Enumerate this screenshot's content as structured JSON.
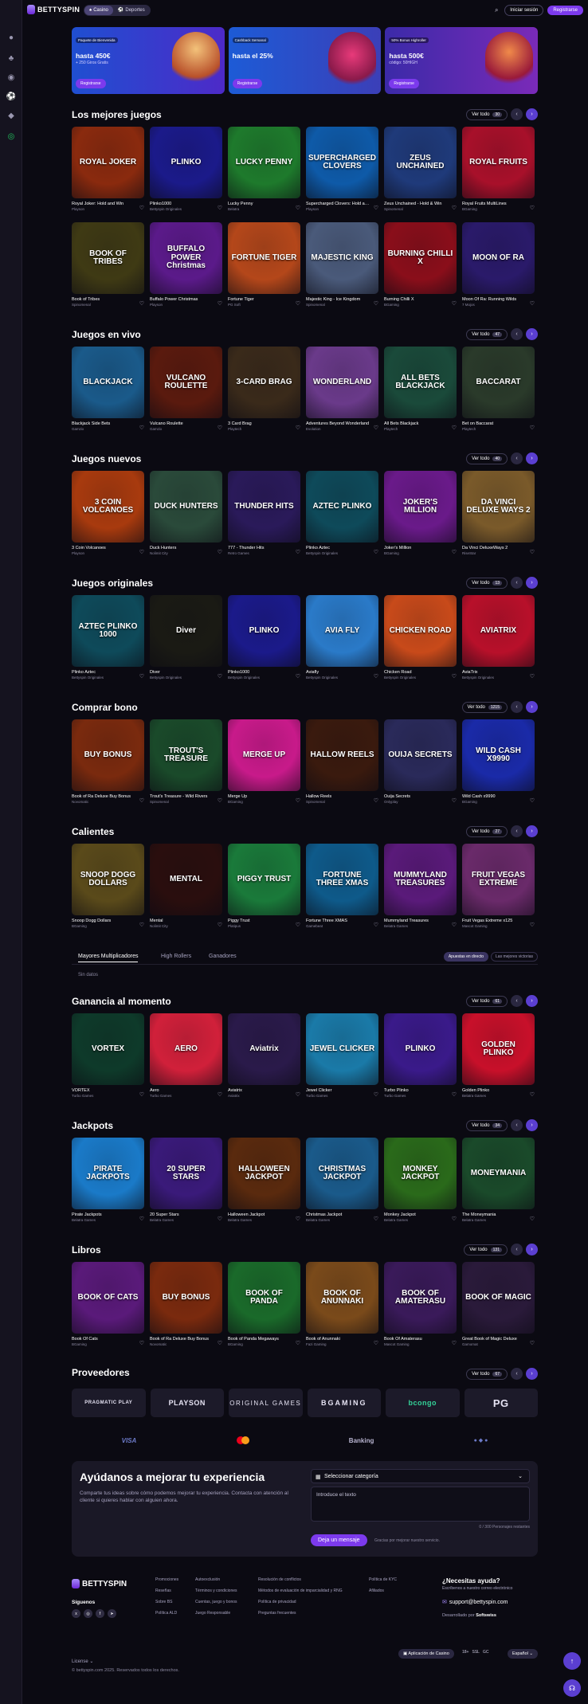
{
  "header": {
    "brand": "BETTYSPIN",
    "tabs": [
      "Casino",
      "Deportes"
    ],
    "login_label": "Iniciar sesión",
    "register_label": "Registrarse"
  },
  "promos": [
    {
      "tag": "Paquete de Bienvenida",
      "amount": "hasta 450€",
      "sub": "+ 250 Giros Gratis",
      "button": "Registrarse",
      "bg": "#1f4fd1"
    },
    {
      "tag": "Cashback Semanal",
      "amount": "hasta el 25%",
      "sub": "",
      "button": "Registrarse",
      "bg": "#1d5bd6"
    },
    {
      "tag": "50% Bonus Highroller",
      "amount": "hasta 500€",
      "sub": "código: 50HIGH",
      "button": "Registrarse",
      "bg": "#3b2aa8"
    }
  ],
  "sections": [
    {
      "title": "Los mejores juegos",
      "vertodo": "Ver todo",
      "count": "30",
      "rows": [
        [
          {
            "name": "Royal Joker: Hold and Win",
            "prov": "Playson",
            "art": "ROYAL JOKER",
            "bg": "#8a2a0e"
          },
          {
            "name": "Plinko1000",
            "prov": "Bettyspin Originales",
            "art": "PLINKO",
            "bg": "#1b1a8a"
          },
          {
            "name": "Lucky Penny",
            "prov": "Belatra",
            "art": "LUCKY PENNY",
            "bg": "#1e7a2c"
          },
          {
            "name": "Supercharged Clovers: Hold and Win",
            "prov": "Playson",
            "art": "SUPERCHARGED CLOVERS",
            "bg": "#0e5aa8"
          },
          {
            "name": "Zeus Unchained - Hold & Win",
            "prov": "Spinomenal",
            "art": "ZEUS UNCHAINED",
            "bg": "#1f3a7a"
          },
          {
            "name": "Royal Fruits MultiLines",
            "prov": "BGaming",
            "art": "ROYAL FRUITS",
            "bg": "#a8102a"
          }
        ],
        [
          {
            "name": "Book of Tribes",
            "prov": "Spinomenal",
            "art": "BOOK OF TRIBES",
            "bg": "#3f3a14"
          },
          {
            "name": "Buffalo Power Christmas",
            "prov": "Playson",
            "art": "BUFFALO POWER Christmas",
            "bg": "#5b1a8a"
          },
          {
            "name": "Fortune Tiger",
            "prov": "PG Soft",
            "art": "FORTUNE TIGER",
            "bg": "#b4471a"
          },
          {
            "name": "Majestic King - Ice Kingdom",
            "prov": "Spinomenal",
            "art": "MAJESTIC KING",
            "bg": "#4a5a7a"
          },
          {
            "name": "Burning Chilli X",
            "prov": "BGaming",
            "art": "BURNING CHILLI X",
            "bg": "#8a0e1a"
          },
          {
            "name": "Moon Of Ra: Running Wilds",
            "prov": "7 Mojos",
            "art": "MOON OF RA",
            "bg": "#2a1a6a"
          }
        ]
      ]
    },
    {
      "title": "Juegos en vivo",
      "vertodo": "Ver todo",
      "count": "47",
      "rows": [
        [
          {
            "name": "Blackjack Side Bets",
            "prov": "Gamzix",
            "art": "BLACKJACK",
            "bg": "#1a5a8a"
          },
          {
            "name": "Vulcano Roulette",
            "prov": "Gamzix",
            "art": "VULCANO ROULETTE",
            "bg": "#5a1a0e"
          },
          {
            "name": "3 Card Brag",
            "prov": "Playtech",
            "art": "3-CARD BRAG",
            "bg": "#3a2a1a"
          },
          {
            "name": "Adventures Beyond Wonderland",
            "prov": "Evolution",
            "art": "WONDERLAND",
            "bg": "#6a3a8a"
          },
          {
            "name": "All Bets Blackjack",
            "prov": "Playtech",
            "art": "ALL BETS BLACKJACK",
            "bg": "#1a4a3a"
          },
          {
            "name": "Bet on Baccarat",
            "prov": "Playtech",
            "art": "BACCARAT",
            "bg": "#2a3a2a"
          }
        ]
      ]
    },
    {
      "title": "Juegos nuevos",
      "vertodo": "Ver todo",
      "count": "40",
      "rows": [
        [
          {
            "name": "3 Coin Volcanoes",
            "prov": "Playson",
            "art": "3 COIN VOLCANOES",
            "bg": "#a83a0e"
          },
          {
            "name": "Duck Hunters",
            "prov": "Nolimit City",
            "art": "DUCK HUNTERS",
            "bg": "#2a4a3a"
          },
          {
            "name": "777 - Thunder Hits",
            "prov": "Retro Games",
            "art": "THUNDER HITS",
            "bg": "#2a1a5a"
          },
          {
            "name": "Plinko Aztec",
            "prov": "Bettyspin Originales",
            "art": "AZTEC PLINKO",
            "bg": "#0e4a5a"
          },
          {
            "name": "Joker's Million",
            "prov": "BGaming",
            "art": "JOKER'S MILLION",
            "bg": "#6a1a8a"
          },
          {
            "name": "Da Vinci DeluxeWays 2",
            "prov": "RiseStar",
            "art": "DA VINCI DELUXE WAYS 2",
            "bg": "#7a5a2a"
          }
        ]
      ]
    },
    {
      "title": "Juegos originales",
      "vertodo": "Ver todo",
      "count": "13",
      "rows": [
        [
          {
            "name": "Plinko Aztec",
            "prov": "Bettyspin Originales",
            "art": "AZTEC PLINKO 1000",
            "bg": "#0e4a5a"
          },
          {
            "name": "Diver",
            "prov": "Bettyspin Originales",
            "art": "Diver",
            "bg": "#1a1a14"
          },
          {
            "name": "Plinko1000",
            "prov": "Bettyspin Originales",
            "art": "PLINKO",
            "bg": "#1b1a8a"
          },
          {
            "name": "Aviafly",
            "prov": "Bettyspin Originales",
            "art": "AVIA FLY",
            "bg": "#2a7ac8"
          },
          {
            "name": "Chicken Road",
            "prov": "Bettyspin Originales",
            "art": "CHICKEN ROAD",
            "bg": "#c84a1a"
          },
          {
            "name": "AviaTrix",
            "prov": "Bettyspin Originales",
            "art": "AVIATRIX",
            "bg": "#b8102a"
          }
        ]
      ]
    },
    {
      "title": "Comprar bono",
      "vertodo": "Ver todo",
      "count": "1215",
      "rows": [
        [
          {
            "name": "Book of Ra Deluxe Buy Bonus",
            "prov": "Novomatic",
            "art": "BUY BONUS",
            "bg": "#7a2a0e"
          },
          {
            "name": "Trout's Treasure - Wild Rivers",
            "prov": "Spinomenal",
            "art": "TROUT'S TREASURE",
            "bg": "#1a4a2a"
          },
          {
            "name": "Merge Up",
            "prov": "BGaming",
            "art": "MERGE UP",
            "bg": "#c81a8a"
          },
          {
            "name": "Hallow Reels",
            "prov": "Spinomenal",
            "art": "HALLOW REELS",
            "bg": "#3a1a0e"
          },
          {
            "name": "Ouija Secrets",
            "prov": "Onlyplay",
            "art": "OUIJA SECRETS",
            "bg": "#2a2a5a"
          },
          {
            "name": "Wild Cash x9990",
            "prov": "BGaming",
            "art": "WILD CASH X9990",
            "bg": "#1a2aa8"
          }
        ]
      ]
    },
    {
      "title": "Calientes",
      "vertodo": "Ver todo",
      "count": "27",
      "rows": [
        [
          {
            "name": "Snoop Dogg Dollars",
            "prov": "BGaming",
            "art": "SNOOP DOGG DOLLARS",
            "bg": "#5a4a1a"
          },
          {
            "name": "Mental",
            "prov": "Nolimit City",
            "art": "MENTAL",
            "bg": "#2a0e0e"
          },
          {
            "name": "Piggy Trust",
            "prov": "Platipus",
            "art": "PIGGY TRUST",
            "bg": "#1a7a3a"
          },
          {
            "name": "Fortune Three XMAS",
            "prov": "Gamebeat",
            "art": "FORTUNE THREE XMAS",
            "bg": "#0e5a8a"
          },
          {
            "name": "Mummyland Treasures",
            "prov": "Belatra Games",
            "art": "MUMMYLAND TREASURES",
            "bg": "#5a1a7a"
          },
          {
            "name": "Fruit Vegas Extreme x125",
            "prov": "Mascot Gaming",
            "art": "FRUIT VEGAS EXTREME",
            "bg": "#6a2a6a"
          }
        ]
      ]
    }
  ],
  "winners": {
    "tabs": [
      "Mayores Multiplicadores",
      "High Rollers",
      "Ganadores"
    ],
    "toggle": [
      "Apuestas en directo",
      "Las mejores victorias"
    ],
    "empty": "Sin datos"
  },
  "sections2": [
    {
      "title": "Ganancia al momento",
      "vertodo": "Ver todo",
      "count": "61",
      "rows": [
        [
          {
            "name": "VORTEX",
            "prov": "Turbo Games",
            "art": "VORTEX",
            "bg": "#0e3a2a"
          },
          {
            "name": "Aero",
            "prov": "Turbo Games",
            "art": "AERO",
            "bg": "#d1203a"
          },
          {
            "name": "Aviatrix",
            "prov": "Aviatrix",
            "art": "Aviatrix",
            "bg": "#2a1a4a"
          },
          {
            "name": "Jewel Clicker",
            "prov": "Turbo Games",
            "art": "JEWEL CLICKER",
            "bg": "#1a7aa8"
          },
          {
            "name": "Turbo Plinko",
            "prov": "Turbo Games",
            "art": "PLINKO",
            "bg": "#3a1a8a"
          },
          {
            "name": "Golden Plinko",
            "prov": "Belatra Games",
            "art": "GOLDEN PLINKO",
            "bg": "#c8102a"
          }
        ]
      ]
    },
    {
      "title": "Jackpots",
      "vertodo": "Ver todo",
      "count": "34",
      "rows": [
        [
          {
            "name": "Pirate Jackpots",
            "prov": "Belatra Games",
            "art": "PIRATE JACKPOTS",
            "bg": "#1a7ac8"
          },
          {
            "name": "20 Super Stars",
            "prov": "Belatra Games",
            "art": "20 SUPER STARS",
            "bg": "#3a1a7a"
          },
          {
            "name": "Halloween Jackpot",
            "prov": "Belatra Games",
            "art": "HALLOWEEN JACKPOT",
            "bg": "#5a2a0e"
          },
          {
            "name": "Christmas Jackpot",
            "prov": "Belatra Games",
            "art": "CHRISTMAS JACKPOT",
            "bg": "#1a5a8a"
          },
          {
            "name": "Monkey Jackpot",
            "prov": "Belatra Games",
            "art": "MONKEY JACKPOT",
            "bg": "#2a6a1a"
          },
          {
            "name": "The Moneymania",
            "prov": "Belatra Games",
            "art": "MONEYMANIA",
            "bg": "#1a4a2a"
          }
        ]
      ]
    },
    {
      "title": "Libros",
      "vertodo": "Ver todo",
      "count": "131",
      "rows": [
        [
          {
            "name": "Book Of Cats",
            "prov": "BGaming",
            "art": "BOOK OF CATS",
            "bg": "#5a1a7a"
          },
          {
            "name": "Book of Ra Deluxe Buy Bonus",
            "prov": "Novomatic",
            "art": "BUY BONUS",
            "bg": "#7a2a0e"
          },
          {
            "name": "Book of Panda Megaways",
            "prov": "BGaming",
            "art": "BOOK OF PANDA",
            "bg": "#1a6a2a"
          },
          {
            "name": "Book of Anunnaki",
            "prov": "Fazi Gaming",
            "art": "BOOK OF ANUNNAKI",
            "bg": "#7a4a1a"
          },
          {
            "name": "Book Of Amaterasu",
            "prov": "Mascot Gaming",
            "art": "BOOK OF AMATERASU",
            "bg": "#3a1a5a"
          },
          {
            "name": "Great Book of Magic Deluxe",
            "prov": "Gamomat",
            "art": "BOOK OF MAGIC",
            "bg": "#2a1a3a"
          }
        ]
      ]
    }
  ],
  "providers": {
    "title": "Proveedores",
    "vertodo": "Ver todo",
    "count": "67",
    "items": [
      "PRAGMATIC PLAY",
      "PLAYSON",
      "ORIGINAL GAMES",
      "BGAMING",
      "bcongo",
      "PG"
    ]
  },
  "payments": [
    "VISA",
    "Mastercard",
    "Banking",
    "e-wallets"
  ],
  "feedback": {
    "title": "Ayúdanos a mejorar tu experiencia",
    "desc": "Comparte tus ideas sobre cómo podemos mejorar tu experiencia. Contacta con atención al cliente si quieres hablar con alguien ahora.",
    "select_placeholder": "Seleccionar categoría",
    "text_placeholder": "Introduce el texto",
    "counter": "0 / 300 Personajes restantes",
    "send": "Deja un mensaje",
    "note": "Gracias por mejorar nuestro servicio."
  },
  "footer": {
    "brand": "BETTYSPIN",
    "follow": "Síguenos",
    "col1": [
      "Promociones",
      "Reseñas",
      "Sobre BS",
      "Política ALD"
    ],
    "col2": [
      "Autoexclusión",
      "Términos y condiciones",
      "Cuentas, juego y bonos",
      "Juego Responsable"
    ],
    "col3": [
      "Resolución de conflictos",
      "Métodos de evaluación de imparcialidad y RNG",
      "Política de privacidad",
      "Preguntas frecuentes"
    ],
    "col4": [
      "Política de KYC",
      "Afiliados"
    ],
    "help_title": "¿Necesitas ayuda?",
    "help_sub": "Escríbenos a nuestro correo electrónico",
    "email": "support@bettyspin.com",
    "dev": "Desarrollado por",
    "dev_brand": "Softswiss",
    "license": "License",
    "copyright": "© bettyspin.com 2025. Reservados todos los derechos.",
    "app": "Aplicación de Casino",
    "lang": "Español"
  }
}
